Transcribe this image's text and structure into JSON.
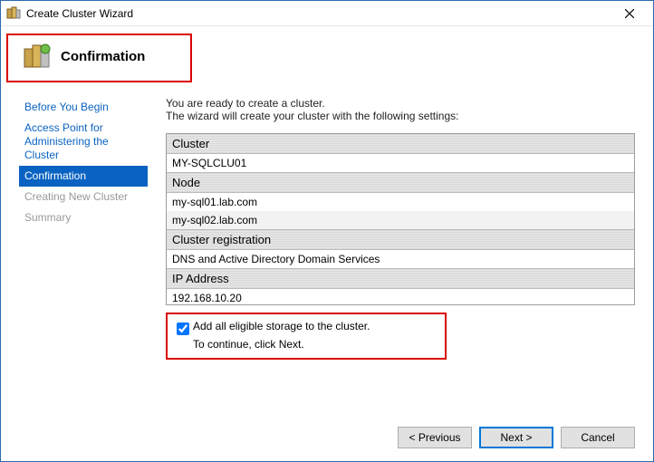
{
  "window": {
    "title": "Create Cluster Wizard"
  },
  "header": {
    "title": "Confirmation"
  },
  "sidebar": {
    "items": [
      {
        "label": "Before You Begin"
      },
      {
        "label": "Access Point for Administering the Cluster"
      },
      {
        "label": "Confirmation"
      },
      {
        "label": "Creating New Cluster"
      },
      {
        "label": "Summary"
      }
    ]
  },
  "main": {
    "intro1": "You are ready to create a cluster.",
    "intro2": "The wizard will create your cluster with the following settings:",
    "sections": [
      {
        "heading": "Cluster",
        "rows": [
          "MY-SQLCLU01"
        ]
      },
      {
        "heading": "Node",
        "rows": [
          "my-sql01.lab.com",
          "my-sql02.lab.com"
        ]
      },
      {
        "heading": "Cluster registration",
        "rows": [
          "DNS and Active Directory Domain Services"
        ]
      },
      {
        "heading": "IP Address",
        "rows": [
          "192.168.10.20"
        ]
      }
    ],
    "checkbox": {
      "label": "Add all eligible storage to the cluster.",
      "checked": true
    },
    "continue": "To continue, click Next."
  },
  "buttons": {
    "previous": "< Previous",
    "next": "Next >",
    "cancel": "Cancel"
  }
}
